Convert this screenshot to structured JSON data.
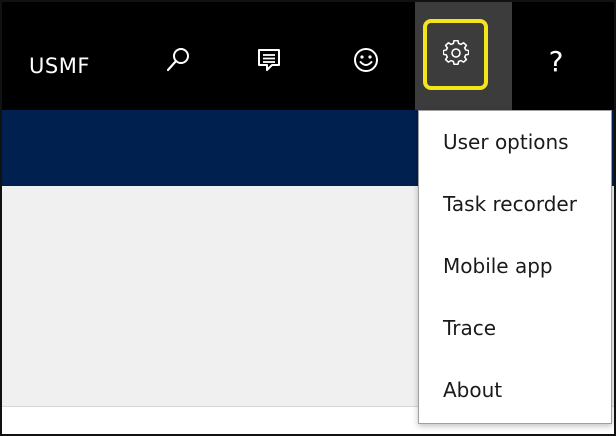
{
  "header": {
    "company": "USMF",
    "icons": [
      "search-icon",
      "feedback-icon",
      "smiley-icon",
      "gear-icon",
      "help-icon"
    ],
    "help_label": "?"
  },
  "settings_menu": {
    "items": [
      {
        "label": "User options"
      },
      {
        "label": "Task recorder"
      },
      {
        "label": "Mobile app"
      },
      {
        "label": "Trace"
      },
      {
        "label": "About"
      }
    ]
  },
  "colors": {
    "topbar": "#000000",
    "nav_band": "#002050",
    "content_bg": "#f0f0f0",
    "highlight": "#f2e61a",
    "active_button_bg": "#3c3c3c"
  }
}
